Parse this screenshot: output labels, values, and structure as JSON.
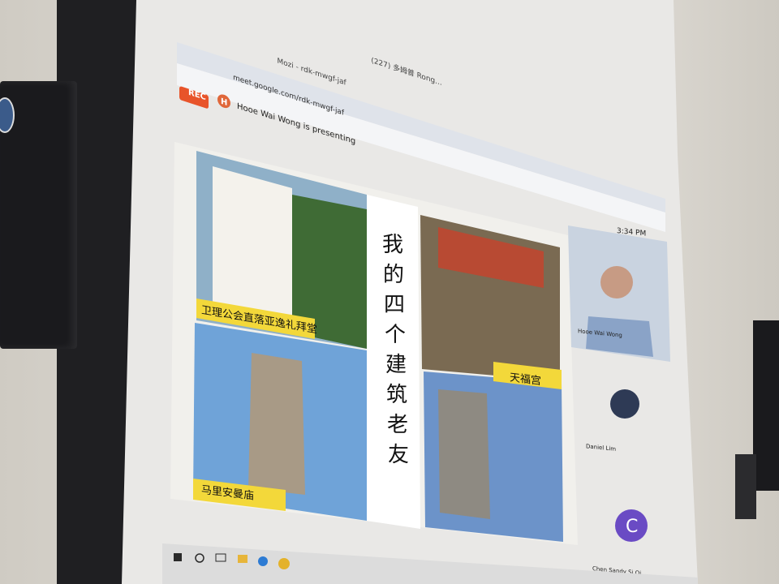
{
  "browser": {
    "tabs": [
      {
        "label": "Mozi - rdk-mwgf-jaf"
      },
      {
        "label": "(227) 多姆普 Rong..."
      }
    ],
    "url": "meet.google.com/rdk-mwgf-jaf",
    "rec_label": "REC",
    "avatar_letter": "H",
    "presenting_text": "Hooe Wai Wong is presenting"
  },
  "slide": {
    "title_chars": [
      "我",
      "的",
      "四",
      "个",
      "建",
      "筑",
      "老",
      "友"
    ],
    "captions": {
      "top_left": "卫理公会直落亚逸礼拜堂",
      "top_right": "天福宫",
      "bottom_left": "马里安曼庙"
    }
  },
  "participants": [
    {
      "name": "Hooe Wai Wong"
    },
    {
      "name": "Daniel Lim"
    },
    {
      "name": "Chen Sandy Si Qi",
      "avatar_letter": "C"
    }
  ],
  "status": {
    "time": "3:34 PM"
  },
  "colors": {
    "rec_bg": "#e8542a",
    "caption_bg": "#f3d83a",
    "avatar_purple": "#6a4bc4",
    "avatar_h": "#e0673a"
  }
}
